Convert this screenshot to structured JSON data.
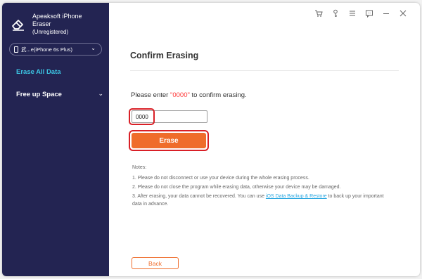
{
  "app": {
    "name": "Apeaksoft iPhone Eraser",
    "registration": "(Unregistered)"
  },
  "device_select": {
    "value": "武...e(iPhone 6s Plus)"
  },
  "sidebar": {
    "items": [
      {
        "label": "Erase All Data",
        "active": true
      },
      {
        "label": "Free up Space",
        "active": false
      }
    ]
  },
  "toolbar": {
    "icons": [
      "cart-icon",
      "key-icon",
      "menu-icon",
      "feedback-icon",
      "minimize-icon",
      "close-icon"
    ]
  },
  "main": {
    "title": "Confirm Erasing",
    "instruction_prefix": "Please enter ",
    "instruction_code": "\"0000\"",
    "instruction_suffix": " to confirm erasing.",
    "input_value": "0000",
    "erase_label": "Erase",
    "notes_title": "Notes:",
    "note1": "1. Please do not disconnect or use your device during the whole erasing process.",
    "note2": "2. Please do not close the program while erasing data, otherwise your device may be damaged.",
    "note3_before": "3. After erasing, your data cannot be recovered. You can use ",
    "note3_link": "iOS Data Backup & Restore",
    "note3_after": " to back up your important data in advance.",
    "back_label": "Back"
  },
  "colors": {
    "sidebar_bg": "#232452",
    "accent_cyan": "#3cc6e4",
    "accent_orange": "#ef6c2b",
    "highlight_red": "#d91f26",
    "code_red": "#ff3333"
  }
}
